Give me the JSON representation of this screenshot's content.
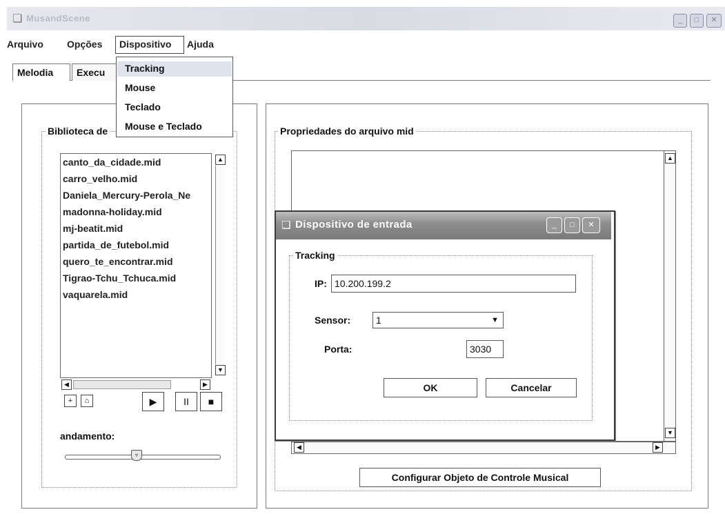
{
  "window": {
    "title": "MusandScene",
    "app_icon": "app-icon",
    "controls": [
      "minimize-icon",
      "maximize-icon",
      "close-icon"
    ]
  },
  "menubar": {
    "items": [
      {
        "label": "Arquivo"
      },
      {
        "label": "Opções"
      },
      {
        "label": "Dispositivo"
      },
      {
        "label": "Ajuda"
      }
    ]
  },
  "dropdown": {
    "items": [
      {
        "label": "Tracking"
      },
      {
        "label": "Mouse"
      },
      {
        "label": "Teclado"
      },
      {
        "label": "Mouse e Teclado"
      }
    ]
  },
  "tabs": [
    {
      "label": "Melodia"
    },
    {
      "label": "Execu"
    }
  ],
  "library": {
    "title": "Biblioteca de",
    "files": [
      "canto_da_cidade.mid",
      "carro_velho.mid",
      "Daniela_Mercury-Perola_Ne",
      "madonna-holiday.mid",
      "mj-beatit.mid",
      "partida_de_futebol.mid",
      "quero_te_encontrar.mid",
      "Tigrao-Tchu_Tchuca.mid",
      "vaquarela.mid"
    ],
    "add_icon": "add-file-icon",
    "delete_icon": "trash-icon",
    "playback": {
      "play": "▶",
      "pause": "II",
      "stop": "■"
    }
  },
  "tempo": {
    "label": "andamento:",
    "value": 0.45
  },
  "properties": {
    "title": "Propriedades do arquivo mid",
    "button_label": "Configurar Objeto de Controle Musical"
  },
  "dialog": {
    "title": "Dispositivo de entrada",
    "group_title": "Tracking",
    "ip_label": "IP:",
    "ip_value": "10.200.199.2",
    "sensor_label": "Sensor:",
    "sensor_value": "1",
    "port_label": "Porta:",
    "port_value": "3030",
    "ok_label": "OK",
    "cancel_label": "Cancelar"
  }
}
